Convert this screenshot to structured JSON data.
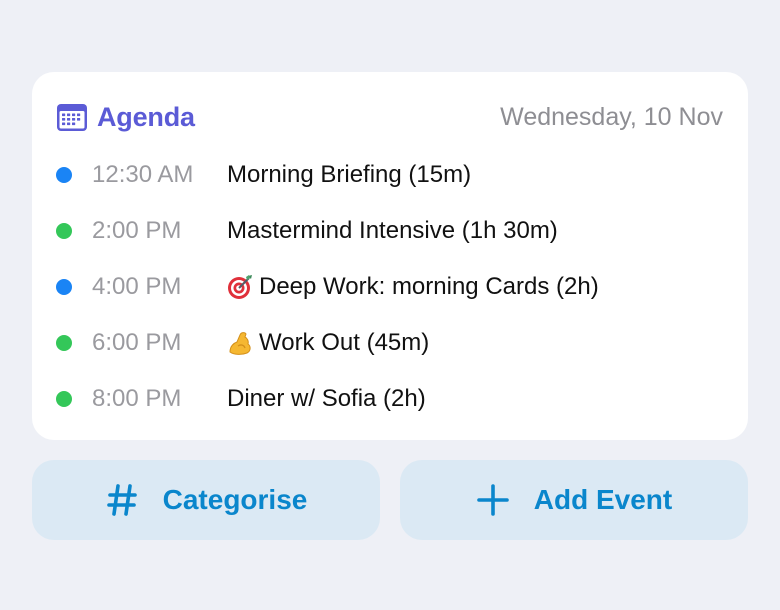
{
  "agenda": {
    "title": "Agenda",
    "date": "Wednesday, 10 Nov",
    "icon": "calendar-icon",
    "accent_color": "#5b5bd6"
  },
  "events": [
    {
      "time": "12:30 AM",
      "title": "Morning Briefing (15m)",
      "dot_color": "#1a84f5",
      "emoji": null
    },
    {
      "time": "2:00 PM",
      "title": "Mastermind Intensive (1h 30m)",
      "dot_color": "#34c759",
      "emoji": null
    },
    {
      "time": "4:00 PM",
      "title": "Deep Work: morning Cards (2h)",
      "dot_color": "#1a84f5",
      "emoji": "target-dart-icon"
    },
    {
      "time": "6:00 PM",
      "title": "Work Out (45m)",
      "dot_color": "#34c759",
      "emoji": "flexed-bicep-icon"
    },
    {
      "time": "8:00 PM",
      "title": "Diner w/ Sofia (2h)",
      "dot_color": "#34c759",
      "emoji": null
    }
  ],
  "actions": {
    "categorise_label": "Categorise",
    "categorise_icon": "hashtag-icon",
    "add_event_label": "Add Event",
    "add_event_icon": "plus-icon",
    "button_color": "#0a86cc",
    "button_bg": "#dbe9f4"
  }
}
